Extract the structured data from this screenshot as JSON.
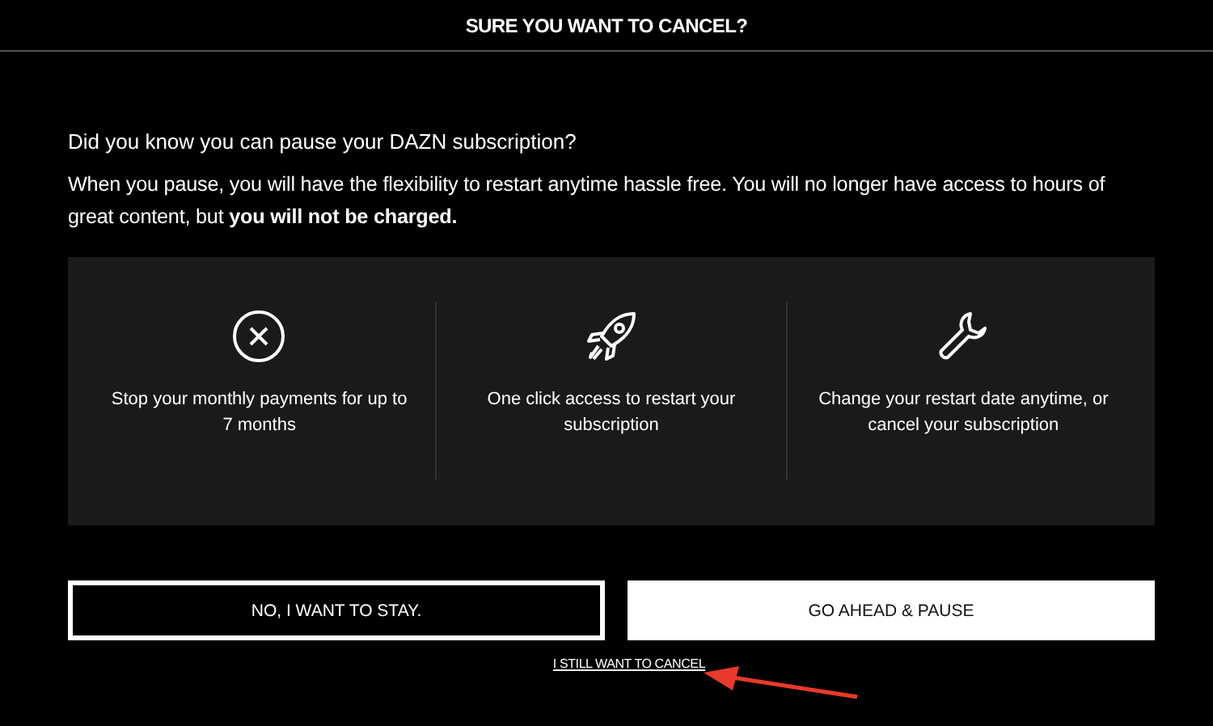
{
  "dialog": {
    "title": "SURE YOU WANT TO CANCEL?"
  },
  "question": "Did you know you can pause your DAZN subscription?",
  "explanation": "When you pause, you will have the flexibility to restart anytime hassle free. You will no longer have access to hours of great content, but **you will not be charged.**",
  "features": [
    {
      "kind": "cancel",
      "text": "Stop your monthly payments for up to 7 months"
    },
    {
      "kind": "rocket",
      "text": "One click access to restart your subscription"
    },
    {
      "kind": "wrench",
      "text": "Change your restart date anytime, or cancel your subscription"
    }
  ],
  "buttons": [
    {
      "label": "NO, I WANT TO STAY.",
      "kind": "outline"
    },
    {
      "label": "GO AHEAD & PAUSE",
      "kind": "solid"
    }
  ],
  "cancel_link": "I STILL WANT TO CANCEL",
  "annotation": {
    "kind": "arrow"
  }
}
